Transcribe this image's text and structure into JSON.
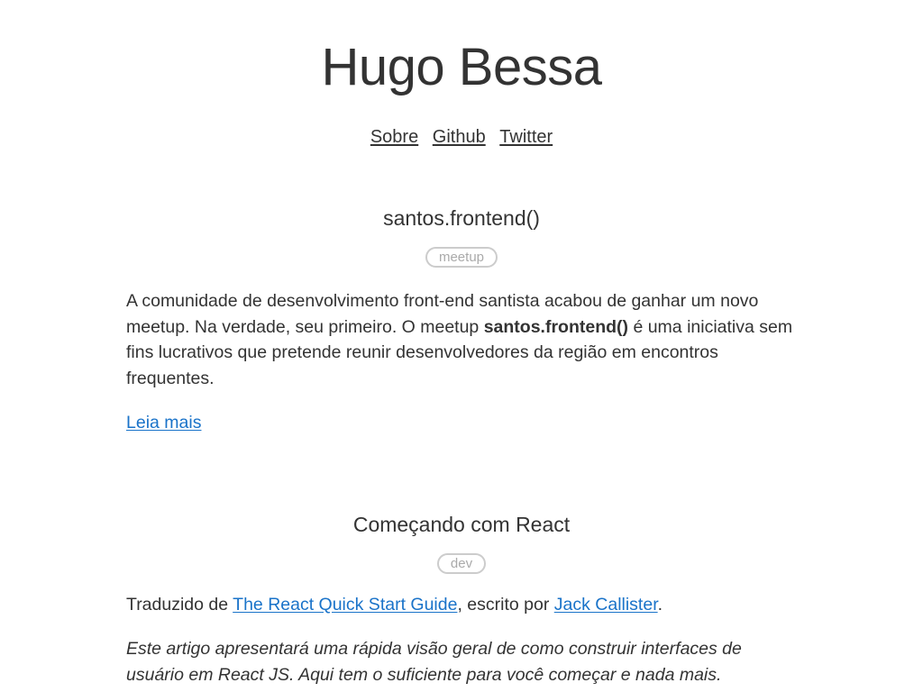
{
  "site": {
    "title": "Hugo Bessa",
    "nav": [
      {
        "label": "Sobre"
      },
      {
        "label": "Github"
      },
      {
        "label": "Twitter"
      }
    ]
  },
  "posts": [
    {
      "title": "santos.frontend()",
      "tag": "meetup",
      "body_before": "A comunidade de desenvolvimento front-end santista acabou de ganhar um novo meetup. Na verdade, seu primeiro. O meetup ",
      "body_strong": "santos.frontend()",
      "body_after": " é uma iniciativa sem fins lucrativos que pretende reunir desenvolvedores da região em encontros frequentes.",
      "read_more": "Leia mais"
    },
    {
      "title": "Começando com React",
      "tag": "dev",
      "translated_prefix": "Traduzido de ",
      "source_link": "The React Quick Start Guide",
      "author_prefix": ", escrito por ",
      "author_link": "Jack Callister",
      "author_suffix": ".",
      "intro": "Este artigo apresentará uma rápida visão geral de como construir interfaces de usuário em React JS. Aqui tem o suficiente para você começar e nada mais."
    }
  ],
  "colors": {
    "text": "#333333",
    "link": "#1a73c9",
    "tag_border": "#cccccc",
    "tag_text": "#aaaaaa"
  }
}
